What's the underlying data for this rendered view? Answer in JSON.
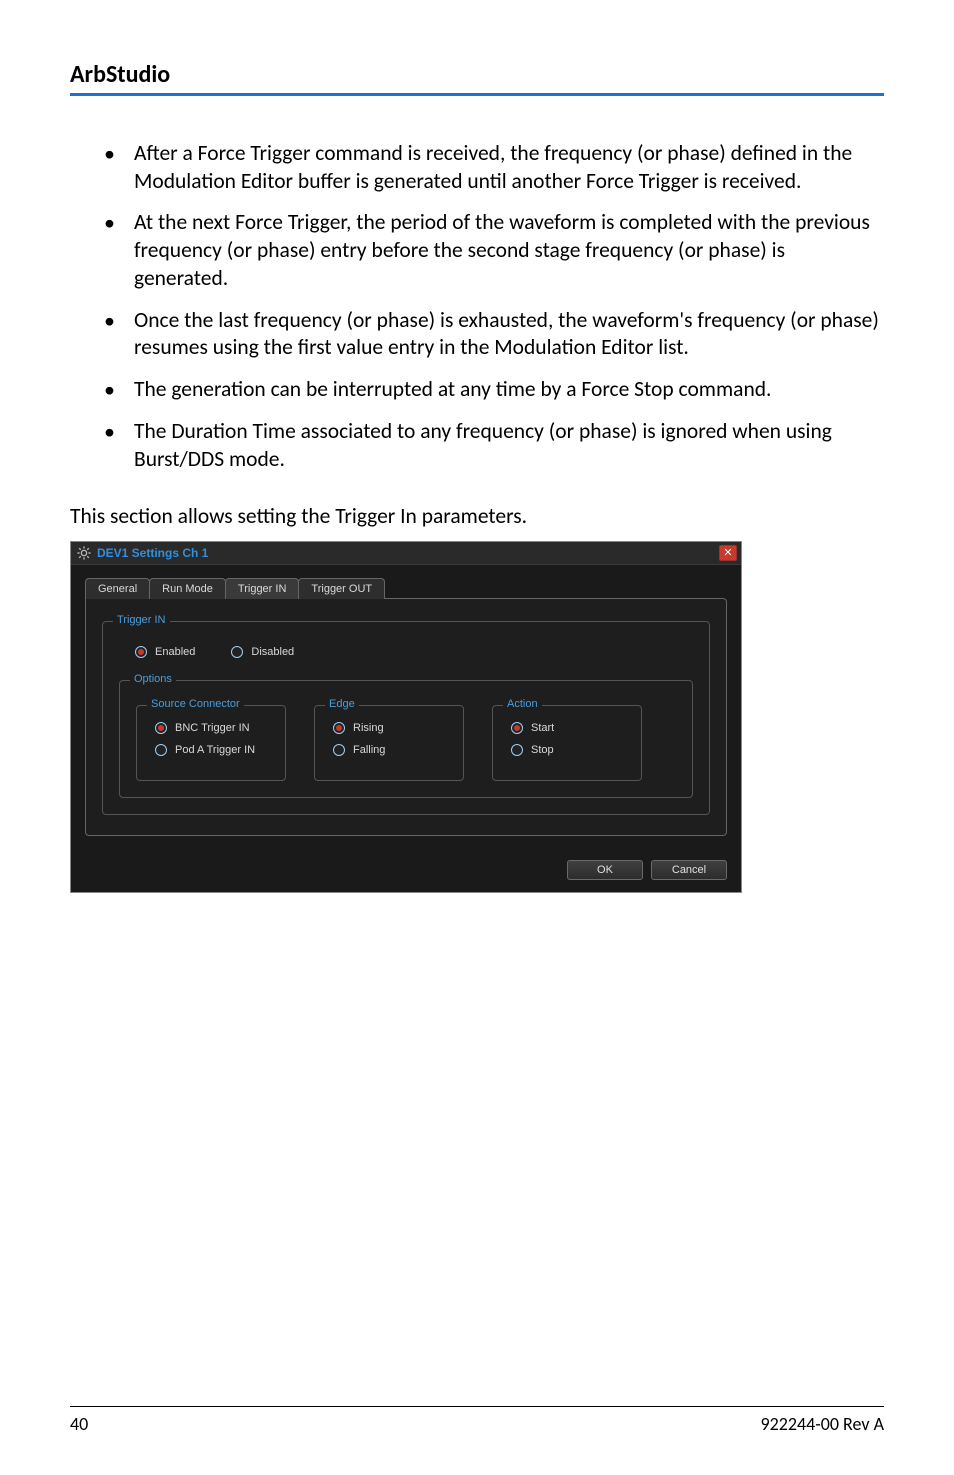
{
  "header": {
    "title": "ArbStudio"
  },
  "bullets": [
    "After a Force Trigger command is received, the frequency (or phase) defined in the Modulation Editor buffer is generated until another Force Trigger is received.",
    "At the next Force Trigger, the period of the waveform is completed with the previous frequency (or phase) entry before the second stage frequency (or phase) is generated.",
    "Once the last frequency (or phase) is exhausted, the waveform's frequency (or phase) resumes using the first value entry in the Modulation Editor list.",
    "The generation can be interrupted at any time by a Force Stop command.",
    "The Duration Time associated to any frequency (or phase) is ignored when using Burst/DDS mode."
  ],
  "section_intro": "This section allows setting the Trigger In parameters.",
  "dialog": {
    "title": "DEV1 Settings Ch 1",
    "tabs": {
      "general": "General",
      "run_mode": "Run Mode",
      "trigger_in": "Trigger IN",
      "trigger_out": "Trigger OUT"
    },
    "group_trigger_in": {
      "legend": "Trigger IN",
      "enabled": "Enabled",
      "disabled": "Disabled"
    },
    "group_options": {
      "legend": "Options",
      "source": {
        "legend": "Source Connector",
        "bnc": "BNC Trigger IN",
        "pod": "Pod A Trigger IN"
      },
      "edge": {
        "legend": "Edge",
        "rising": "Rising",
        "falling": "Falling"
      },
      "action": {
        "legend": "Action",
        "start": "Start",
        "stop": "Stop"
      }
    },
    "buttons": {
      "ok": "OK",
      "cancel": "Cancel"
    }
  },
  "footer": {
    "page": "40",
    "doc": "922244-00 Rev A"
  }
}
